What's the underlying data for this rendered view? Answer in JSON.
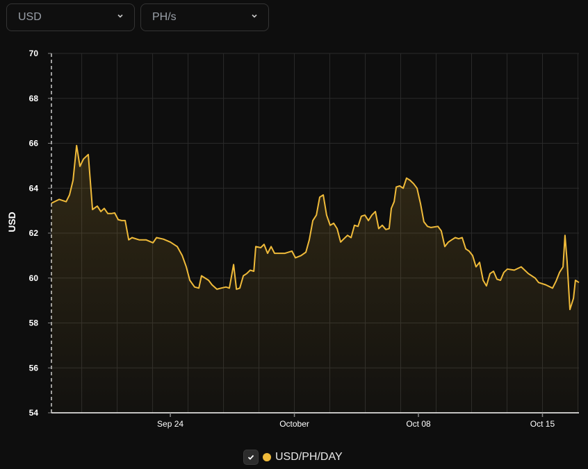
{
  "controls": {
    "currency": "USD",
    "unit": "PH/s"
  },
  "colors": {
    "line": "#f0bb3a",
    "grid": "#2a2a2a",
    "axis": "#ffffff"
  },
  "chart_data": {
    "type": "area",
    "ylabel": "USD",
    "ylim": [
      54,
      70
    ],
    "yticks": [
      54,
      56,
      58,
      60,
      62,
      64,
      66,
      68,
      70
    ],
    "x_unit": "days since Sep 17",
    "xlim": [
      0.29,
      30.06
    ],
    "xticks": [
      {
        "t": 7,
        "label": "Sep 24"
      },
      {
        "t": 14,
        "label": "October"
      },
      {
        "t": 21,
        "label": "Oct 08"
      },
      {
        "t": 28,
        "label": "Oct 15"
      }
    ],
    "series": [
      {
        "name": "USD/PH/DAY",
        "points": [
          [
            0.29,
            63.33
          ],
          [
            0.73,
            63.5
          ],
          [
            1.12,
            63.4
          ],
          [
            1.31,
            63.7
          ],
          [
            1.51,
            64.35
          ],
          [
            1.71,
            65.9
          ],
          [
            1.9,
            64.97
          ],
          [
            2.1,
            65.3
          ],
          [
            2.37,
            65.5
          ],
          [
            2.61,
            63.05
          ],
          [
            2.88,
            63.2
          ],
          [
            3.08,
            62.96
          ],
          [
            3.27,
            63.1
          ],
          [
            3.47,
            62.87
          ],
          [
            3.67,
            62.87
          ],
          [
            3.86,
            62.9
          ],
          [
            4.06,
            62.6
          ],
          [
            4.25,
            62.56
          ],
          [
            4.45,
            62.56
          ],
          [
            4.65,
            61.7
          ],
          [
            4.84,
            61.8
          ],
          [
            5.24,
            61.7
          ],
          [
            5.63,
            61.7
          ],
          [
            6.02,
            61.57
          ],
          [
            6.22,
            61.8
          ],
          [
            6.61,
            61.73
          ],
          [
            7.0,
            61.6
          ],
          [
            7.39,
            61.4
          ],
          [
            7.67,
            61.0
          ],
          [
            7.9,
            60.5
          ],
          [
            8.1,
            59.9
          ],
          [
            8.37,
            59.6
          ],
          [
            8.61,
            59.55
          ],
          [
            8.76,
            60.1
          ],
          [
            9.16,
            59.9
          ],
          [
            9.35,
            59.7
          ],
          [
            9.63,
            59.5
          ],
          [
            9.86,
            59.55
          ],
          [
            10.14,
            59.6
          ],
          [
            10.33,
            59.55
          ],
          [
            10.57,
            60.6
          ],
          [
            10.73,
            59.5
          ],
          [
            10.92,
            59.55
          ],
          [
            11.12,
            60.1
          ],
          [
            11.31,
            60.2
          ],
          [
            11.51,
            60.35
          ],
          [
            11.71,
            60.3
          ],
          [
            11.82,
            61.4
          ],
          [
            12.1,
            61.35
          ],
          [
            12.29,
            61.5
          ],
          [
            12.49,
            61.1
          ],
          [
            12.69,
            61.4
          ],
          [
            12.88,
            61.1
          ],
          [
            13.08,
            61.1
          ],
          [
            13.47,
            61.1
          ],
          [
            13.86,
            61.2
          ],
          [
            14.06,
            60.9
          ],
          [
            14.37,
            61.0
          ],
          [
            14.65,
            61.15
          ],
          [
            14.84,
            61.7
          ],
          [
            15.04,
            62.56
          ],
          [
            15.24,
            62.8
          ],
          [
            15.43,
            63.6
          ],
          [
            15.63,
            63.7
          ],
          [
            15.82,
            62.8
          ],
          [
            16.02,
            62.35
          ],
          [
            16.22,
            62.44
          ],
          [
            16.41,
            62.2
          ],
          [
            16.61,
            61.6
          ],
          [
            16.8,
            61.75
          ],
          [
            17.0,
            61.9
          ],
          [
            17.2,
            61.8
          ],
          [
            17.39,
            62.35
          ],
          [
            17.59,
            62.3
          ],
          [
            17.78,
            62.75
          ],
          [
            17.98,
            62.8
          ],
          [
            18.18,
            62.56
          ],
          [
            18.37,
            62.8
          ],
          [
            18.57,
            62.96
          ],
          [
            18.76,
            62.2
          ],
          [
            18.96,
            62.35
          ],
          [
            19.16,
            62.16
          ],
          [
            19.35,
            62.2
          ],
          [
            19.47,
            63.1
          ],
          [
            19.63,
            63.4
          ],
          [
            19.75,
            64.05
          ],
          [
            19.94,
            64.1
          ],
          [
            20.14,
            64.0
          ],
          [
            20.33,
            64.45
          ],
          [
            20.53,
            64.35
          ],
          [
            20.73,
            64.2
          ],
          [
            20.92,
            64.0
          ],
          [
            21.12,
            63.3
          ],
          [
            21.31,
            62.5
          ],
          [
            21.51,
            62.3
          ],
          [
            21.71,
            62.25
          ],
          [
            22.1,
            62.3
          ],
          [
            22.29,
            62.1
          ],
          [
            22.49,
            61.4
          ],
          [
            22.69,
            61.6
          ],
          [
            22.88,
            61.7
          ],
          [
            23.08,
            61.8
          ],
          [
            23.27,
            61.75
          ],
          [
            23.47,
            61.8
          ],
          [
            23.67,
            61.3
          ],
          [
            23.86,
            61.2
          ],
          [
            24.06,
            61.0
          ],
          [
            24.25,
            60.5
          ],
          [
            24.45,
            60.7
          ],
          [
            24.65,
            59.9
          ],
          [
            24.84,
            59.65
          ],
          [
            25.04,
            60.2
          ],
          [
            25.24,
            60.3
          ],
          [
            25.43,
            59.95
          ],
          [
            25.63,
            59.9
          ],
          [
            25.82,
            60.25
          ],
          [
            26.02,
            60.4
          ],
          [
            26.41,
            60.35
          ],
          [
            26.8,
            60.5
          ],
          [
            27.2,
            60.2
          ],
          [
            27.59,
            60.0
          ],
          [
            27.78,
            59.8
          ],
          [
            28.18,
            59.7
          ],
          [
            28.57,
            59.55
          ],
          [
            28.76,
            59.85
          ],
          [
            28.96,
            60.25
          ],
          [
            29.16,
            60.5
          ],
          [
            29.27,
            61.9
          ],
          [
            29.39,
            60.75
          ],
          [
            29.55,
            58.6
          ],
          [
            29.75,
            59.1
          ],
          [
            29.86,
            59.9
          ],
          [
            30.06,
            59.8
          ]
        ]
      }
    ]
  },
  "legend": {
    "label": "USD/PH/DAY",
    "checked": true
  }
}
